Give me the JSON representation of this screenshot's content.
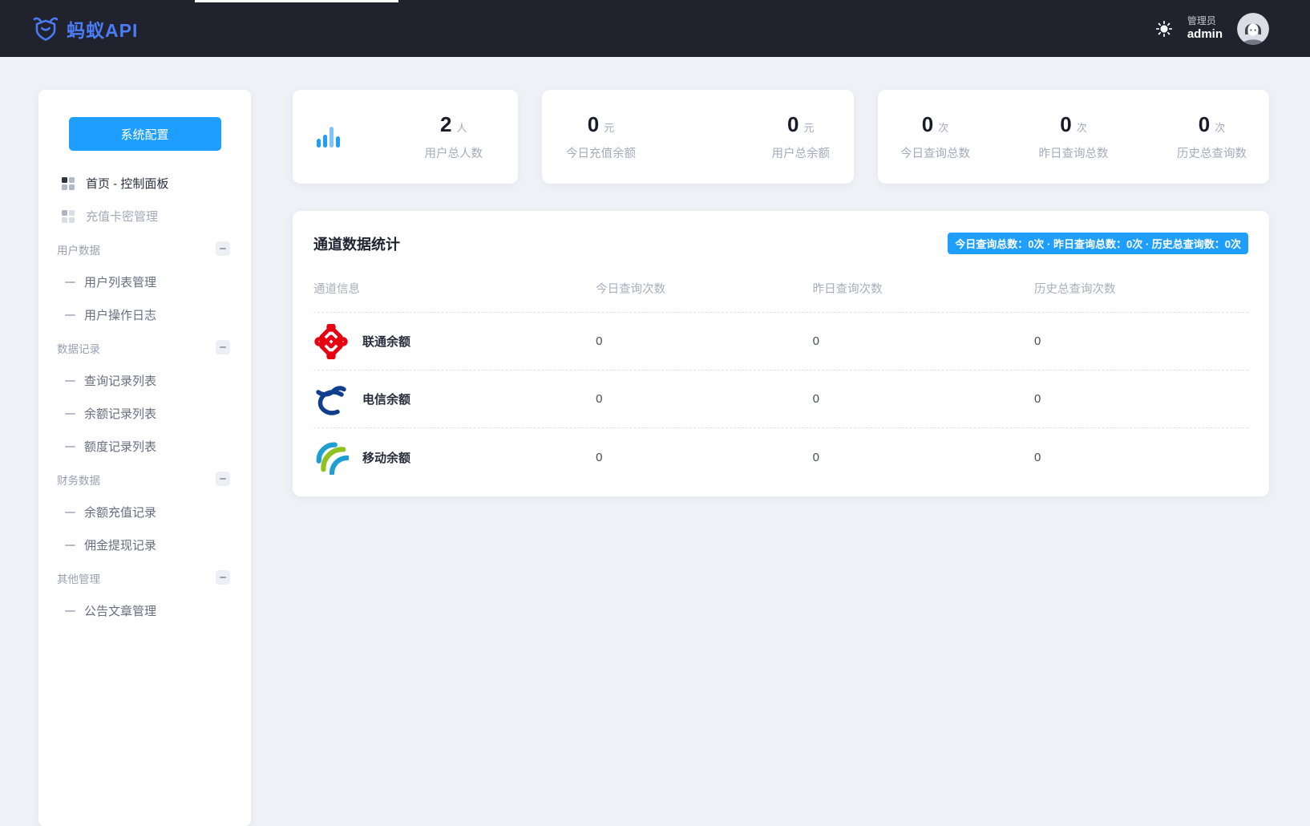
{
  "header": {
    "logo_text": "蚂蚁API",
    "role_label": "管理员",
    "username": "admin"
  },
  "sidebar": {
    "config_button_label": "系统配置",
    "items": [
      {
        "type": "link",
        "icon": "grid-icon",
        "label": "首页 - 控制面板",
        "active": true
      },
      {
        "type": "link",
        "icon": "grid-icon",
        "label": "充值卡密管理",
        "active": false
      },
      {
        "type": "section",
        "icon": "minus-icon",
        "label": "用户数据"
      },
      {
        "type": "sub",
        "label": "用户列表管理"
      },
      {
        "type": "sub",
        "label": "用户操作日志"
      },
      {
        "type": "section",
        "icon": "minus-icon",
        "label": "数据记录"
      },
      {
        "type": "sub",
        "label": "查询记录列表"
      },
      {
        "type": "sub",
        "label": "余额记录列表"
      },
      {
        "type": "sub",
        "label": "额度记录列表"
      },
      {
        "type": "section",
        "icon": "minus-icon",
        "label": "财务数据"
      },
      {
        "type": "sub",
        "label": "余额充值记录"
      },
      {
        "type": "sub",
        "label": "佣金提现记录"
      },
      {
        "type": "section",
        "icon": "minus-icon",
        "label": "其他管理"
      },
      {
        "type": "sub",
        "label": "公告文章管理"
      }
    ]
  },
  "stat_cards": [
    {
      "icon": "bar-chart-icon",
      "stats": [
        {
          "value": "2",
          "unit": "人",
          "label": "用户总人数"
        }
      ]
    },
    {
      "stats": [
        {
          "value": "0",
          "unit": "元",
          "label": "今日充值余额"
        },
        {
          "value": "0",
          "unit": "元",
          "label": "用户总余额"
        }
      ]
    },
    {
      "stats": [
        {
          "value": "0",
          "unit": "次",
          "label": "今日查询总数"
        },
        {
          "value": "0",
          "unit": "次",
          "label": "昨日查询总数"
        },
        {
          "value": "0",
          "unit": "次",
          "label": "历史总查询数"
        }
      ]
    }
  ],
  "channel_panel": {
    "title": "通道数据统计",
    "badge": "今日查询总数：0次 · 昨日查询总数：0次 · 历史总查询数：0次",
    "columns": [
      "通道信息",
      "今日查询次数",
      "昨日查询次数",
      "历史总查询次数"
    ],
    "rows": [
      {
        "operator": "unicom",
        "icon": "china-unicom-logo",
        "name": "联通余额",
        "today": "0",
        "yesterday": "0",
        "total": "0"
      },
      {
        "operator": "telecom",
        "icon": "china-telecom-logo",
        "name": "电信余额",
        "today": "0",
        "yesterday": "0",
        "total": "0"
      },
      {
        "operator": "mobile",
        "icon": "china-mobile-logo",
        "name": "移动余额",
        "today": "0",
        "yesterday": "0",
        "total": "0"
      }
    ]
  },
  "colors": {
    "accent": "#1e9fff",
    "header_bg": "#20222e",
    "page_bg": "#eef1f6",
    "logo_blue": "#4a7cf5",
    "unicom_red": "#e60012",
    "telecom_blue": "#103e8f",
    "mobile_blue": "#1e9fd2",
    "mobile_green": "#8dc21f"
  }
}
